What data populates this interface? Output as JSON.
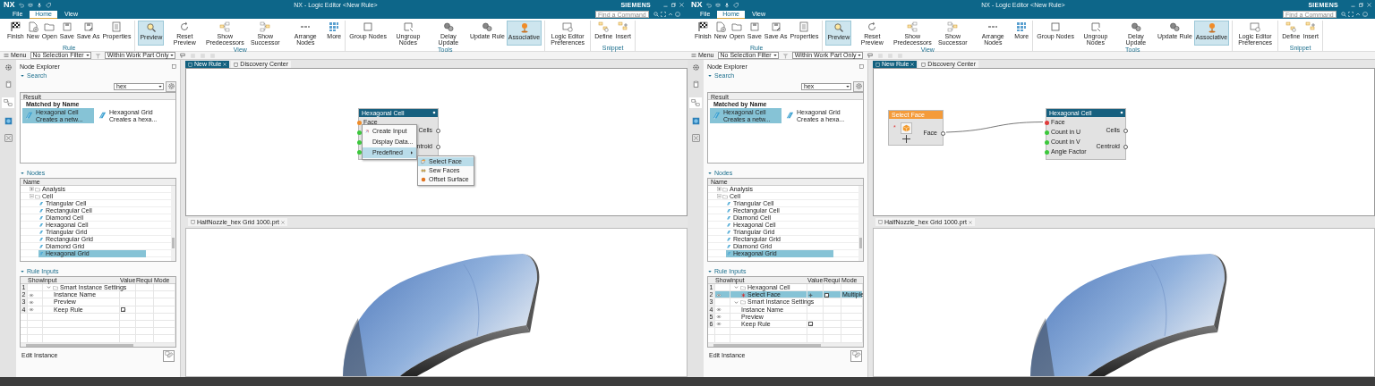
{
  "windows": [
    {
      "title_bar": {
        "logo": "NX",
        "title": "NX - Logic Editor <New Rule>",
        "brand": "SIEMENS"
      },
      "menu_tabs": [
        {
          "label": "File",
          "selected": false
        },
        {
          "label": "Home",
          "selected": true
        },
        {
          "label": "View",
          "selected": false
        }
      ],
      "command_search": {
        "placeholder": "Find a Command"
      },
      "ribbon": [
        {
          "group": "Rule",
          "buttons": [
            {
              "label": "Finish",
              "selected": false
            },
            {
              "label": "New",
              "selected": false
            },
            {
              "label": "Open",
              "selected": false
            },
            {
              "label": "Save",
              "selected": false
            },
            {
              "label": "Save As",
              "selected": false
            },
            {
              "label": "Properties",
              "selected": false
            }
          ]
        },
        {
          "group": "View",
          "buttons": [
            {
              "label": "Preview",
              "selected": true
            },
            {
              "label": "Reset Preview",
              "selected": false
            },
            {
              "label": "Show Predecessors",
              "selected": false
            },
            {
              "label": "Show Successor",
              "selected": false
            },
            {
              "label": "Arrange Nodes",
              "selected": false
            },
            {
              "label": "More",
              "selected": false
            }
          ]
        },
        {
          "group": "Tools",
          "buttons": [
            {
              "label": "Group Nodes",
              "selected": false
            },
            {
              "label": "Ungroup Nodes",
              "selected": false
            },
            {
              "label": "Delay Update",
              "selected": false
            },
            {
              "label": "Update Rule",
              "selected": false
            },
            {
              "label": "Associative",
              "selected": true
            }
          ]
        },
        {
          "buttons": [
            {
              "label": "Logic Editor Preferences",
              "selected": false
            }
          ]
        },
        {
          "group": "Snippet",
          "buttons": [
            {
              "label": "Define",
              "selected": false
            },
            {
              "label": "Insert",
              "selected": false
            }
          ]
        }
      ],
      "toolbar": {
        "menu": "Menu",
        "selection_filter": "No Selection Filter",
        "scope": "Within Work Part Only"
      },
      "explorer": {
        "title": "Node Explorer",
        "search_heading": "Search",
        "search_value": "hex",
        "result_header": "Result",
        "match_group": "Matched by Name",
        "results": [
          {
            "name": "Hexagonal Cell",
            "description": "Creates a netw...",
            "selected": true
          },
          {
            "name": "Hexagonal Grid",
            "description": "Creates a hexa...",
            "selected": false
          }
        ],
        "nodes_heading": "Nodes",
        "tree_header": "Name",
        "tree": [
          {
            "label": "Analysis",
            "kind": "folder",
            "expanded": false,
            "selected": false
          },
          {
            "label": "Cell",
            "kind": "folder",
            "expanded": true,
            "selected": false,
            "children": [
              {
                "label": "Triangular Cell",
                "kind": "node",
                "selected": false
              },
              {
                "label": "Rectangular Cell",
                "kind": "node",
                "selected": false
              },
              {
                "label": "Diamond Cell",
                "kind": "node",
                "selected": false
              },
              {
                "label": "Hexagonal Cell",
                "kind": "node",
                "selected": false
              },
              {
                "label": "Triangular Grid",
                "kind": "node",
                "selected": false
              },
              {
                "label": "Rectangular Grid",
                "kind": "node",
                "selected": false
              },
              {
                "label": "Diamond Grid",
                "kind": "node",
                "selected": false
              },
              {
                "label": "Hexagonal Grid",
                "kind": "node",
                "selected": true
              }
            ]
          }
        ],
        "inputs_heading": "Rule Inputs",
        "input_columns": [
          "Show",
          "Input",
          "Value",
          "Requi",
          "Mode"
        ],
        "input_rows": [
          {
            "index": "1",
            "kind": "folder",
            "input": "Smart Instance Settings",
            "expanded": true,
            "selected": false,
            "children": [
              {
                "index": "2",
                "kind": "setting",
                "input": "Instance Name",
                "selected": false
              },
              {
                "index": "3",
                "kind": "setting",
                "input": "Preview",
                "selected": false
              },
              {
                "index": "4",
                "kind": "setting",
                "input": "Keep Rule",
                "selected": false,
                "value_checked": true
              }
            ]
          }
        ],
        "edit_instance": "Edit Instance"
      },
      "editor_tabs": [
        {
          "label": "New Rule",
          "selected": true
        },
        {
          "label": "Discovery Center",
          "selected": false
        }
      ],
      "graph": {
        "nodes": [
          {
            "title": "Hexagonal Cell",
            "kind": "logic",
            "inputs": [
              {
                "label": "Face",
                "color": "#f08c28"
              },
              {
                "color": "#3cc83c"
              },
              {
                "color": "#3cc83c"
              },
              {
                "color": "#3cc83c"
              }
            ],
            "outputs": [
              {
                "label": "Cells"
              },
              {
                "label": "ntroid"
              }
            ]
          }
        ],
        "context_menu": {
          "items": [
            {
              "label": "Create Input",
              "selected": false
            },
            {
              "label": "Display Data...",
              "selected": false
            },
            {
              "label": "Predefined",
              "selected": true,
              "submenu": true
            }
          ],
          "submenu": [
            {
              "label": "Select Face",
              "selected": true
            },
            {
              "label": "Sew Faces",
              "selected": false
            },
            {
              "label": "Offset Surface",
              "selected": false
            }
          ]
        }
      },
      "model_tab": "HalfNozzle_hex Grid 1000.prt"
    },
    {
      "title_bar": {
        "logo": "NX",
        "title": "NX - Logic Editor <New Rule>",
        "brand": "SIEMENS"
      },
      "menu_tabs": [
        {
          "label": "File",
          "selected": false
        },
        {
          "label": "Home",
          "selected": true
        },
        {
          "label": "View",
          "selected": false
        }
      ],
      "command_search": {
        "placeholder": "Find a Command"
      },
      "ribbon": [
        {
          "group": "Rule",
          "buttons": [
            {
              "label": "Finish",
              "selected": false
            },
            {
              "label": "New",
              "selected": false
            },
            {
              "label": "Open",
              "selected": false
            },
            {
              "label": "Save",
              "selected": false
            },
            {
              "label": "Save As",
              "selected": false
            },
            {
              "label": "Properties",
              "selected": false
            }
          ]
        },
        {
          "group": "View",
          "buttons": [
            {
              "label": "Preview",
              "selected": true
            },
            {
              "label": "Reset Preview",
              "selected": false
            },
            {
              "label": "Show Predecessors",
              "selected": false
            },
            {
              "label": "Show Successor",
              "selected": false
            },
            {
              "label": "Arrange Nodes",
              "selected": false
            },
            {
              "label": "More",
              "selected": false
            }
          ]
        },
        {
          "group": "Tools",
          "buttons": [
            {
              "label": "Group Nodes",
              "selected": false
            },
            {
              "label": "Ungroup Nodes",
              "selected": false
            },
            {
              "label": "Delay Update",
              "selected": false
            },
            {
              "label": "Update Rule",
              "selected": false
            },
            {
              "label": "Associative",
              "selected": true
            }
          ]
        },
        {
          "buttons": [
            {
              "label": "Logic Editor Preferences",
              "selected": false
            }
          ]
        },
        {
          "group": "Snippet",
          "buttons": [
            {
              "label": "Define",
              "selected": false
            },
            {
              "label": "Insert",
              "selected": false
            }
          ]
        }
      ],
      "toolbar": {
        "menu": "Menu",
        "selection_filter": "No Selection Filter",
        "scope": "Within Work Part Only"
      },
      "explorer": {
        "title": "Node Explorer",
        "search_heading": "Search",
        "search_value": "hex",
        "result_header": "Result",
        "match_group": "Matched by Name",
        "results": [
          {
            "name": "Hexagonal Cell",
            "description": "Creates a netw...",
            "selected": true
          },
          {
            "name": "Hexagonal Grid",
            "description": "Creates a hexa...",
            "selected": false
          }
        ],
        "nodes_heading": "Nodes",
        "tree_header": "Name",
        "tree": [
          {
            "label": "Analysis",
            "kind": "folder",
            "expanded": false,
            "selected": false
          },
          {
            "label": "Cell",
            "kind": "folder",
            "expanded": true,
            "selected": false,
            "children": [
              {
                "label": "Triangular Cell",
                "kind": "node",
                "selected": false
              },
              {
                "label": "Rectangular Cell",
                "kind": "node",
                "selected": false
              },
              {
                "label": "Diamond Cell",
                "kind": "node",
                "selected": false
              },
              {
                "label": "Hexagonal Cell",
                "kind": "node",
                "selected": false
              },
              {
                "label": "Triangular Grid",
                "kind": "node",
                "selected": false
              },
              {
                "label": "Rectangular Grid",
                "kind": "node",
                "selected": false
              },
              {
                "label": "Diamond Grid",
                "kind": "node",
                "selected": false
              },
              {
                "label": "Hexagonal Grid",
                "kind": "node",
                "selected": true
              }
            ]
          }
        ],
        "inputs_heading": "Rule Inputs",
        "input_columns": [
          "Show",
          "Input",
          "Value",
          "Requi",
          "Mode"
        ],
        "input_rows": [
          {
            "index": "1",
            "kind": "folder",
            "input": "Hexagonal Cell",
            "expanded": true,
            "selected": false,
            "children": [
              {
                "index": "2",
                "kind": "input",
                "input": "Select Face",
                "selected": true,
                "required": true,
                "mode": "Multiple"
              }
            ]
          },
          {
            "index": "3",
            "kind": "folder",
            "input": "Smart Instance Settings",
            "expanded": true,
            "selected": false,
            "children": [
              {
                "index": "4",
                "kind": "setting",
                "input": "Instance Name",
                "selected": false
              },
              {
                "index": "5",
                "kind": "setting",
                "input": "Preview",
                "selected": false
              },
              {
                "index": "6",
                "kind": "setting",
                "input": "Keep Rule",
                "selected": false,
                "value_checked": true
              }
            ]
          }
        ],
        "edit_instance": "Edit Instance"
      },
      "editor_tabs": [
        {
          "label": "New Rule",
          "selected": true
        },
        {
          "label": "Discovery Center",
          "selected": false
        }
      ],
      "graph": {
        "nodes": [
          {
            "title": "Select Face",
            "kind": "selection",
            "marker": "*",
            "outputs": [
              {
                "label": "Face",
                "connected": true
              }
            ]
          },
          {
            "title": "Hexagonal Cell",
            "kind": "logic",
            "inputs": [
              {
                "label": "Face",
                "color": "#e03c3c"
              },
              {
                "label": "Count in U",
                "color": "#3cc83c"
              },
              {
                "label": "Count in V",
                "color": "#3cc83c"
              },
              {
                "label": "Angle Factor",
                "color": "#3cc83c"
              }
            ],
            "outputs": [
              {
                "label": "Cells"
              },
              {
                "label": "Centroid"
              }
            ]
          }
        ]
      },
      "model_tab": "HalfNozzle_hex Grid 1000.prt"
    }
  ]
}
